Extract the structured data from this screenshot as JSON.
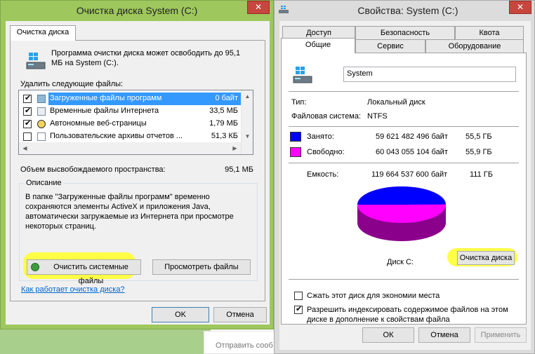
{
  "background": {
    "compose_text": "Отправить сооб"
  },
  "cleanup": {
    "title": "Очистка диска  System (C:)",
    "close_glyph": "✕",
    "tab": "Очистка диска",
    "intro": [
      "Программа очистки диска может освободить до 95,1",
      "МБ на System (C:)."
    ],
    "delete_label": "Удалить следующие файлы:",
    "files": [
      {
        "name": "Загруженные файлы программ",
        "size": "0 байт",
        "checked": true,
        "selected": true
      },
      {
        "name": "Временные файлы Интернета",
        "size": "33,5 МБ",
        "checked": true,
        "selected": false
      },
      {
        "name": "Автономные веб-страницы",
        "size": "1,79 МБ",
        "checked": true,
        "selected": false
      },
      {
        "name": "Пользовательские архивы отчетов ...",
        "size": "51,3 КБ",
        "checked": false,
        "selected": false
      }
    ],
    "freed_label": "Объем высвобождаемого пространства:",
    "freed_value": "95,1 МБ",
    "description_legend": "Описание",
    "description": [
      "В папке \"Загруженные файлы программ\" временно",
      "сохраняются элементы ActiveX и приложения Java,",
      "автоматически загружаемые из Интернета при просмотре",
      "некоторых страниц."
    ],
    "clean_system_button": "Очистить системные файлы",
    "view_files_button": "Просмотреть файлы",
    "how_link": "Как работает очистка диска?",
    "ok": "OK",
    "cancel": "Отмена"
  },
  "props": {
    "title": "Свойства: System (C:)",
    "close_glyph": "✕",
    "tabs_back": [
      "Доступ",
      "Безопасность",
      "Квота"
    ],
    "tabs_front": [
      "Общие",
      "Сервис",
      "Оборудование"
    ],
    "name_value": "System",
    "type_label": "Тип:",
    "type_value": "Локальный диск",
    "fs_label": "Файловая система:",
    "fs_value": "NTFS",
    "used_label": "Занято:",
    "used_bytes": "59 621 482 496 байт",
    "used_gb": "55,5 ГБ",
    "free_label": "Свободно:",
    "free_bytes": "60 043 055 104 байт",
    "free_gb": "55,9 ГБ",
    "capacity_label": "Емкость:",
    "capacity_bytes": "119 664 537 600 байт",
    "capacity_gb": "111 ГБ",
    "disk_label": "Диск C:",
    "cleanup_button": "Очистка диска",
    "compress_label": "Сжать этот диск для экономии места",
    "index_label": [
      "Разрешить индексировать содержимое файлов на этом",
      "диске в дополнение к свойствам файла"
    ],
    "ok": "ОК",
    "cancel": "Отмена",
    "apply": "Применить",
    "used_color": "#0000ff",
    "free_color": "#ff00ff",
    "used_fraction": 0.498
  }
}
